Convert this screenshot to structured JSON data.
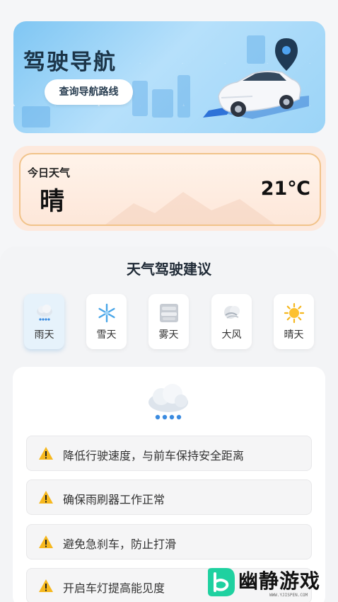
{
  "banner": {
    "title": "驾驶导航",
    "button_label": "查询导航路线"
  },
  "today": {
    "label": "今日天气",
    "condition": "晴",
    "temperature": "21℃"
  },
  "advice": {
    "title": "天气驾驶建议",
    "tabs": [
      {
        "label": "雨天",
        "icon": "rain-cloud-icon",
        "active": true
      },
      {
        "label": "雪天",
        "icon": "snowflake-icon",
        "active": false
      },
      {
        "label": "雾天",
        "icon": "fog-icon",
        "active": false
      },
      {
        "label": "大风",
        "icon": "wind-icon",
        "active": false
      },
      {
        "label": "晴天",
        "icon": "sun-icon",
        "active": false
      }
    ],
    "tips": [
      "降低行驶速度，与前车保持安全距离",
      "确保雨刷器工作正常",
      "避免急刹车，防止打滑",
      "开启车灯提高能见度"
    ]
  },
  "watermark": {
    "text": "幽静游戏",
    "sub": "WWW.YJISPEN.COM"
  },
  "colors": {
    "accent_orange": "#f1c38a",
    "banner_blue": "#8fcdf5",
    "warning_yellow": "#f6b81e",
    "watermark_green": "#1fd1a0"
  }
}
